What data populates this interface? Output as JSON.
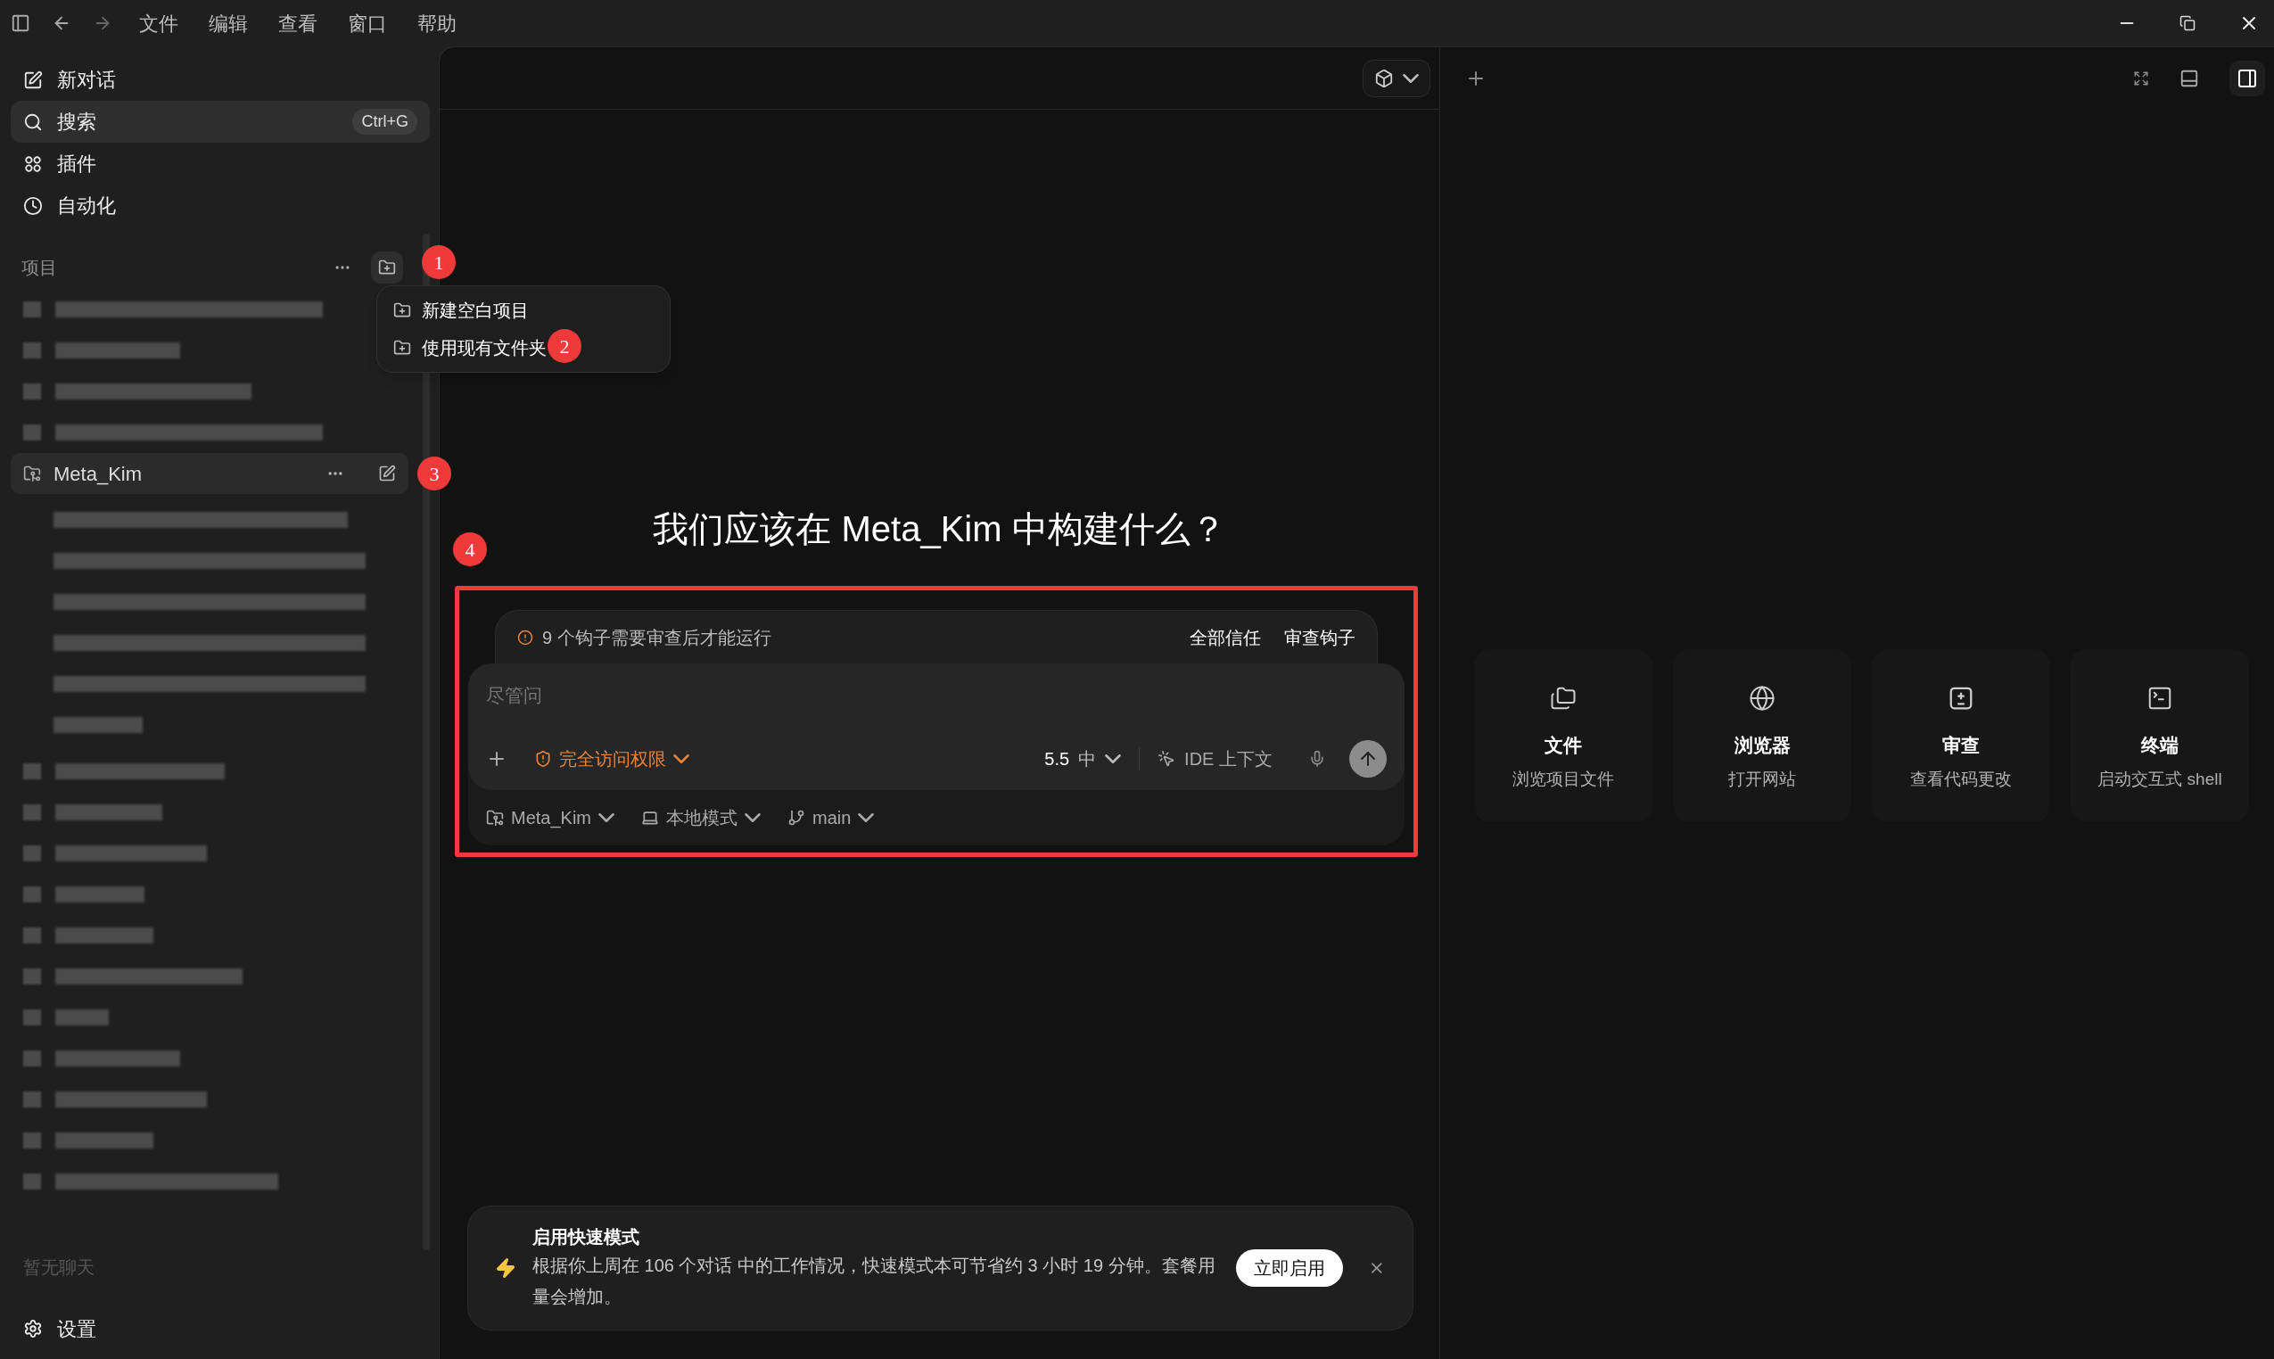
{
  "menu_bar": {
    "items": [
      "文件",
      "编辑",
      "查看",
      "窗口",
      "帮助"
    ]
  },
  "sidebar": {
    "nav": [
      {
        "kind": "compose",
        "label": "新对话",
        "selected": false
      },
      {
        "kind": "search",
        "label": "搜索",
        "shortcut": "Ctrl+G",
        "selected": true
      },
      {
        "kind": "plugins",
        "label": "插件",
        "selected": false
      },
      {
        "kind": "schedule",
        "label": "自动化",
        "selected": false
      }
    ],
    "projects_header": "项目",
    "active_project": {
      "name": "Meta_Kim",
      "selected": true
    },
    "empty_chats": "暂无聊天",
    "settings": "设置"
  },
  "project_menu": {
    "items": [
      "新建空白项目",
      "使用现有文件夹"
    ]
  },
  "markers": [
    "1",
    "2",
    "3",
    "4"
  ],
  "heading": "我们应该在 Meta_Kim 中构建什么？",
  "hooks_notice": {
    "text": "9 个钩子需要审查后才能运行",
    "actions": [
      "全部信任",
      "审查钩子"
    ]
  },
  "composer": {
    "placeholder": "尽管问",
    "access": "完全访问权限",
    "model": "5.5",
    "effort": "中",
    "ide_context": "IDE 上下文",
    "project": "Meta_Kim",
    "mode": "本地模式",
    "branch": "main"
  },
  "fast_mode_banner": {
    "title": "启用快速模式",
    "body": "根据你上周在 106 个对话 中的工作情况，快速模式本可节省约 3 小时 19 分钟。套餐用量会增加。",
    "button": "立即启用"
  },
  "panel_cards": [
    {
      "kind": "files",
      "title": "文件",
      "subtitle": "浏览项目文件"
    },
    {
      "kind": "browser",
      "title": "浏览器",
      "subtitle": "打开网站"
    },
    {
      "kind": "review",
      "title": "审查",
      "subtitle": "查看代码更改"
    },
    {
      "kind": "terminal",
      "title": "终端",
      "subtitle": "启动交互式 shell"
    }
  ]
}
